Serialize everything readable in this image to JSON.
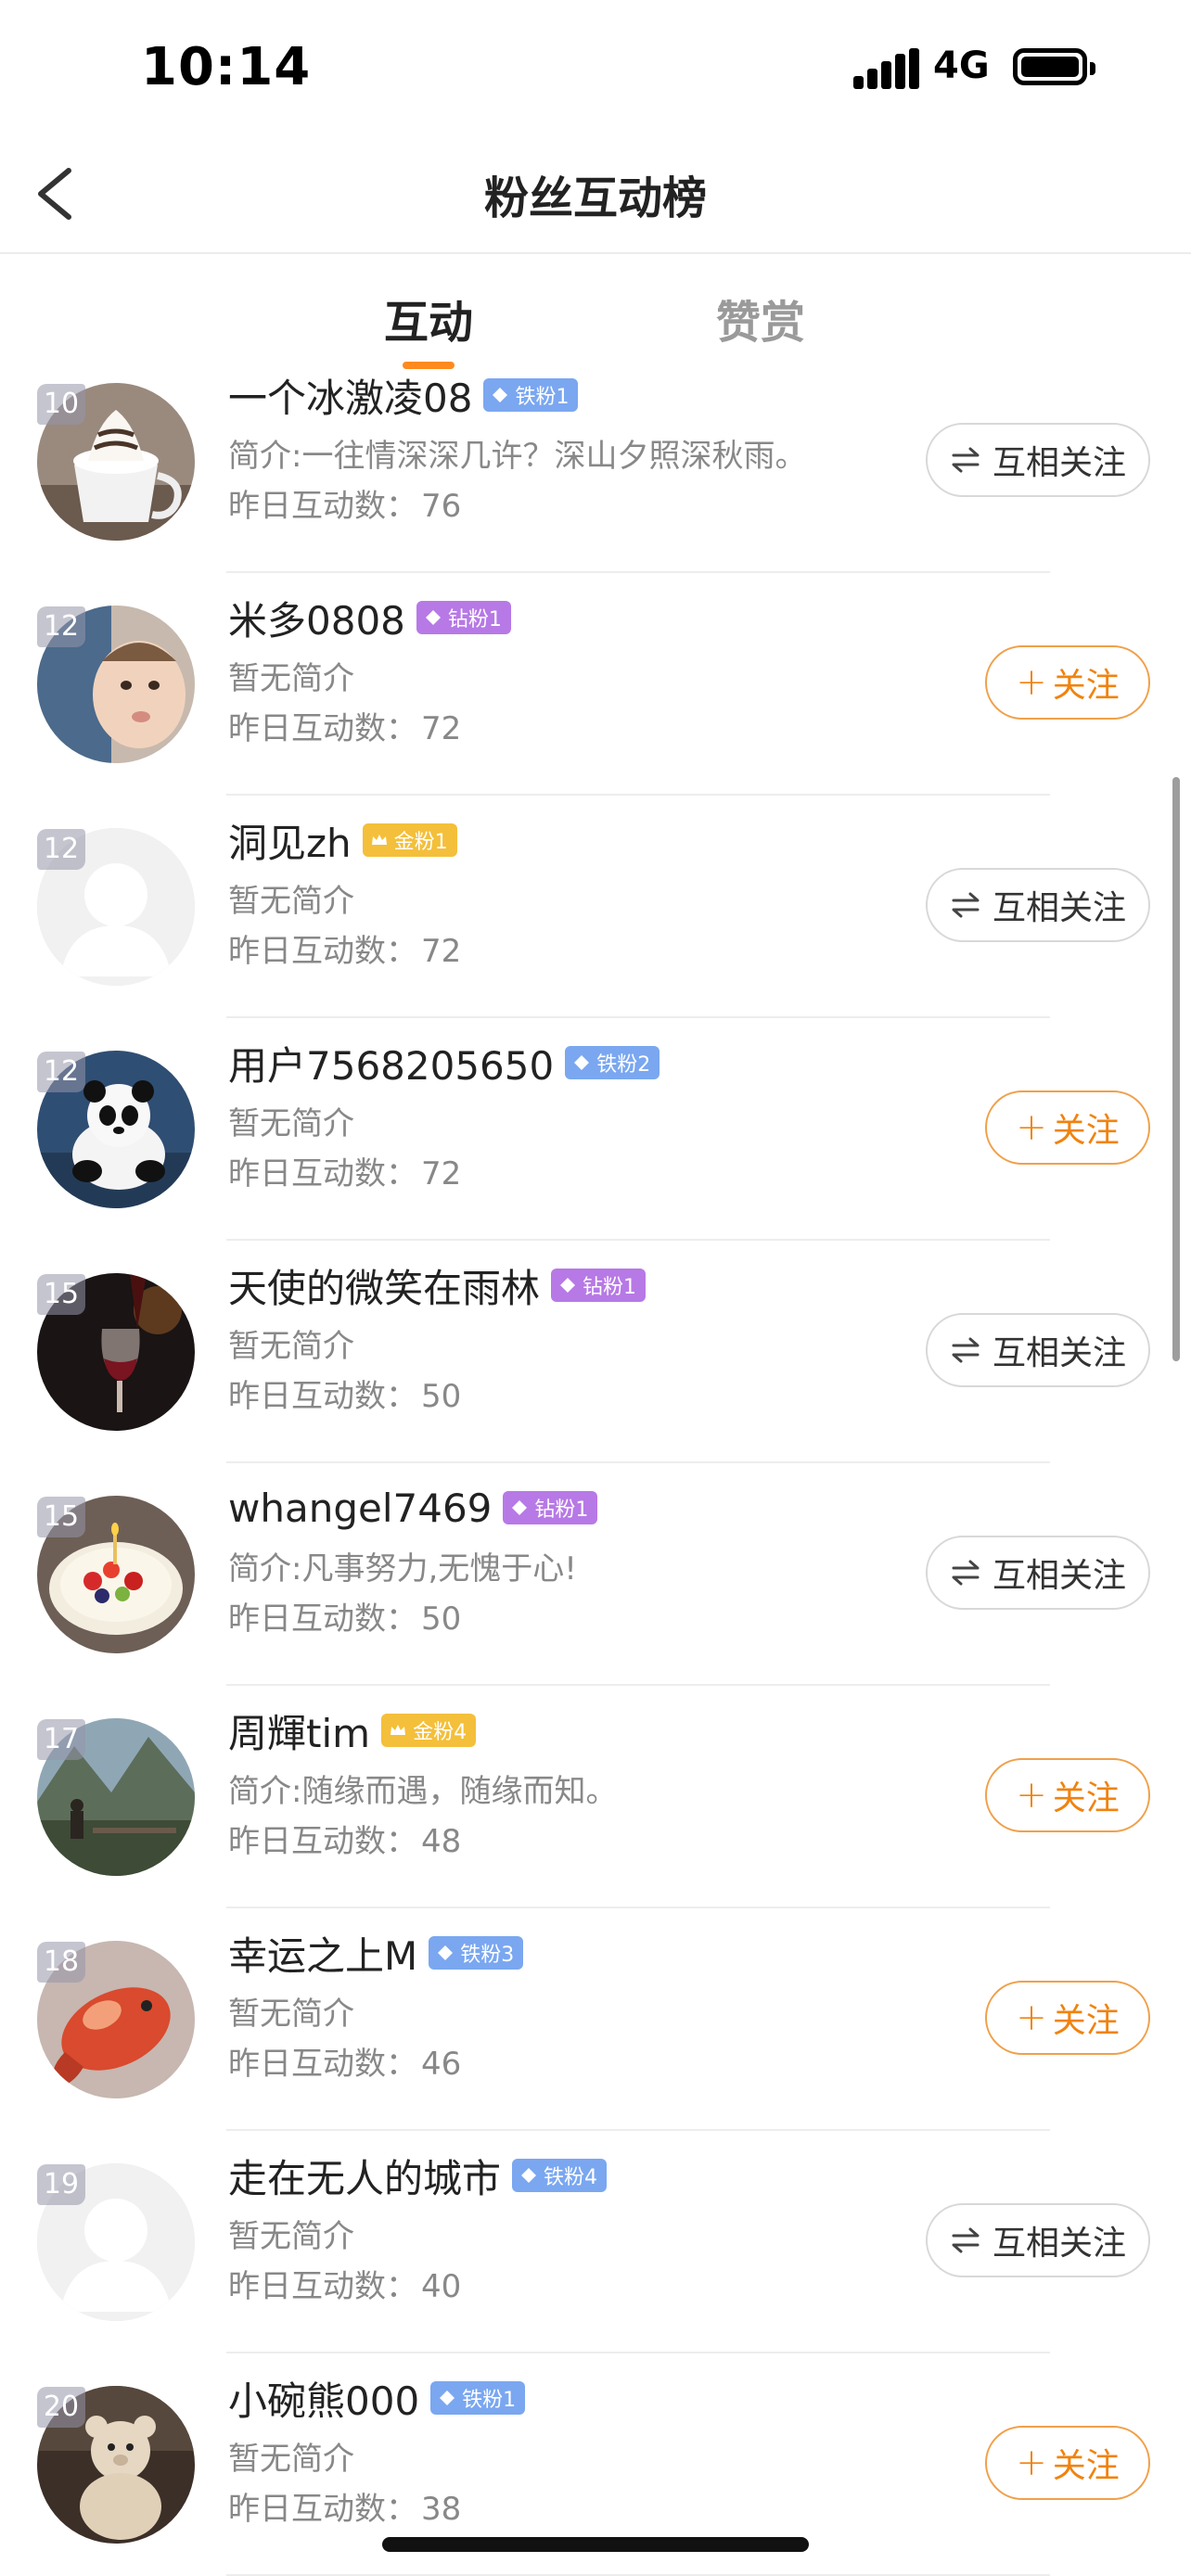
{
  "status_bar": {
    "time": "10:14",
    "network": "4G"
  },
  "nav": {
    "title": "粉丝互动榜"
  },
  "tabs": [
    {
      "label": "互动",
      "active": true
    },
    {
      "label": "赞赏",
      "active": false
    }
  ],
  "labels": {
    "count_prefix": "昨日互动数：",
    "mutual_follow": "互相关注",
    "follow": "关注",
    "plus": "+"
  },
  "colors": {
    "accent": "#ff8a1f",
    "follow_text": "#f0830f",
    "iron": "#7aa7f0",
    "diamond": "#b779e6",
    "gold": "#f4bf3a"
  },
  "fans": [
    {
      "rank": "10",
      "name": "一个冰激凌08",
      "badge": "铁粉1",
      "badge_type": "iron",
      "bio": "简介:一往情深深几许？深山夕照深秋雨。",
      "count": "76",
      "button": "mutual",
      "avatar": "coffee"
    },
    {
      "rank": "12",
      "name": "米多0808",
      "badge": "钻粉1",
      "badge_type": "diamond",
      "bio": "暂无简介",
      "count": "72",
      "button": "follow",
      "avatar": "baby"
    },
    {
      "rank": "12",
      "name": "洞见zh",
      "badge": "金粉1",
      "badge_type": "gold",
      "bio": "暂无简介",
      "count": "72",
      "button": "mutual",
      "avatar": "default"
    },
    {
      "rank": "12",
      "name": "用户7568205650",
      "badge": "铁粉2",
      "badge_type": "iron",
      "bio": "暂无简介",
      "count": "72",
      "button": "follow",
      "avatar": "panda"
    },
    {
      "rank": "15",
      "name": "天使的微笑在雨林",
      "badge": "钻粉1",
      "badge_type": "diamond",
      "bio": "暂无简介",
      "count": "50",
      "button": "mutual",
      "avatar": "wine"
    },
    {
      "rank": "15",
      "name": "whangel7469",
      "badge": "钻粉1",
      "badge_type": "diamond",
      "bio": "简介:凡事努力,无愧于心!",
      "count": "50",
      "button": "mutual",
      "avatar": "cake"
    },
    {
      "rank": "17",
      "name": "周輝tim",
      "badge": "金粉4",
      "badge_type": "gold",
      "bio": "简介:随缘而遇，随缘而知。",
      "count": "48",
      "button": "follow",
      "avatar": "landscape"
    },
    {
      "rank": "18",
      "name": "幸运之上M",
      "badge": "铁粉3",
      "badge_type": "iron",
      "bio": "暂无简介",
      "count": "46",
      "button": "follow",
      "avatar": "koi"
    },
    {
      "rank": "19",
      "name": "走在无人的城市",
      "badge": "铁粉4",
      "badge_type": "iron",
      "bio": "暂无简介",
      "count": "40",
      "button": "mutual",
      "avatar": "default"
    },
    {
      "rank": "20",
      "name": "小碗熊000",
      "badge": "铁粉1",
      "badge_type": "iron",
      "bio": "暂无简介",
      "count": "38",
      "button": "follow",
      "avatar": "bear"
    }
  ]
}
